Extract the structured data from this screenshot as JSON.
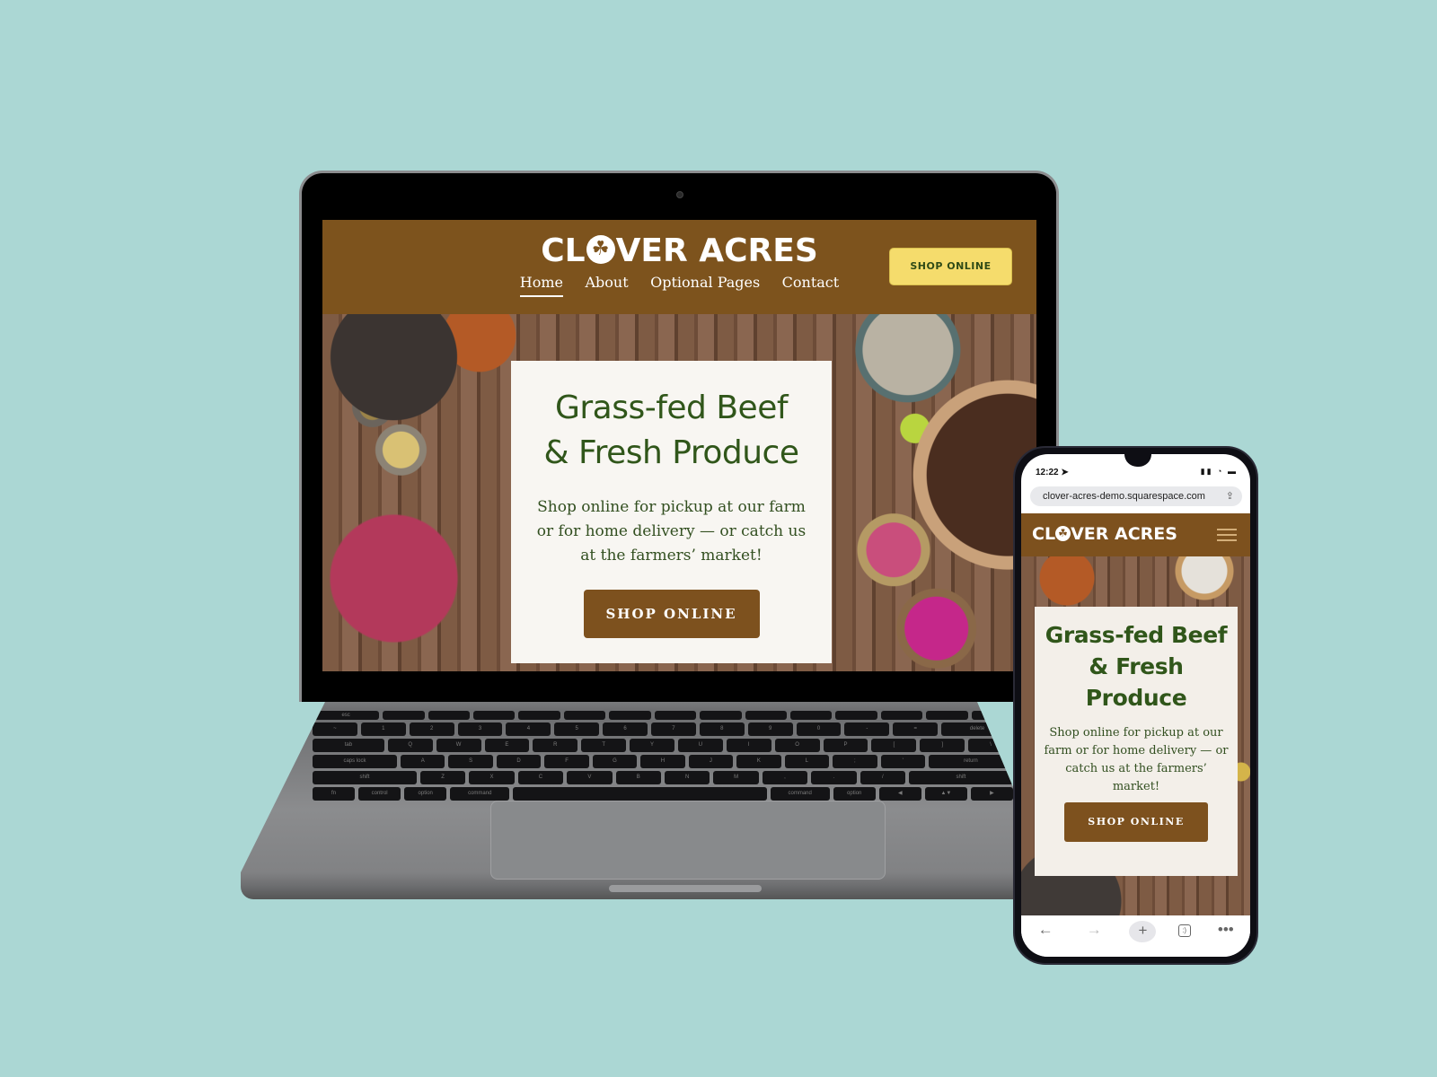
{
  "site": {
    "brand_name": "CLOVER ACRES",
    "brand_prefix": "CL",
    "brand_suffix": "VER ACRES",
    "colors": {
      "header_brown": "#7d531d",
      "cta_yellow": "#f5dc6c",
      "headline_green": "#30561a",
      "card_bg": "#f8f6f2",
      "backdrop_teal": "#abd7d4"
    }
  },
  "laptop": {
    "nav": [
      {
        "label": "Home",
        "active": true
      },
      {
        "label": "About",
        "active": false
      },
      {
        "label": "Optional Pages",
        "active": false
      },
      {
        "label": "Contact",
        "active": false
      }
    ],
    "header_cta": "SHOP ONLINE",
    "hero": {
      "title_line1": "Grass-fed Beef",
      "title_line2": "& Fresh Produce",
      "body": "Shop online for pickup at our farm or for home delivery — or catch us at the farmers’ market!",
      "cta": "SHOP ONLINE"
    },
    "keyboard": {
      "rows": [
        [
          "esc",
          "",
          "",
          "",
          "",
          "",
          "",
          "",
          "",
          "",
          "",
          "",
          "",
          "",
          ""
        ],
        [
          "~",
          "1",
          "2",
          "3",
          "4",
          "5",
          "6",
          "7",
          "8",
          "9",
          "0",
          "-",
          "=",
          "delete"
        ],
        [
          "tab",
          "Q",
          "W",
          "E",
          "R",
          "T",
          "Y",
          "U",
          "I",
          "O",
          "P",
          "[",
          "]",
          "\\"
        ],
        [
          "caps lock",
          "A",
          "S",
          "D",
          "F",
          "G",
          "H",
          "J",
          "K",
          "L",
          ";",
          "'",
          "return"
        ],
        [
          "shift",
          "Z",
          "X",
          "C",
          "V",
          "B",
          "N",
          "M",
          ",",
          ".",
          "/",
          "shift"
        ],
        [
          "fn",
          "control",
          "option",
          "command",
          "",
          "command",
          "option",
          "◀",
          "▲▼",
          "▶"
        ]
      ]
    }
  },
  "phone": {
    "status_time": "12:22 ➤",
    "status_icons": "▮▮ ◔ ▬",
    "url": "clover-acres-demo.squarespace.com",
    "hero": {
      "title_line1": "Grass-fed Beef",
      "title_line2": "& Fresh",
      "title_line3": "Produce",
      "body": "Shop online for pickup at our farm or for home delivery — or catch us at the farmers’ market!",
      "cta": "SHOP ONLINE"
    },
    "toolbar": {
      "back": "←",
      "forward": "→",
      "new_tab": "+",
      "tabs": ":)",
      "more": "•••"
    },
    "share_glyph": "⇪"
  }
}
